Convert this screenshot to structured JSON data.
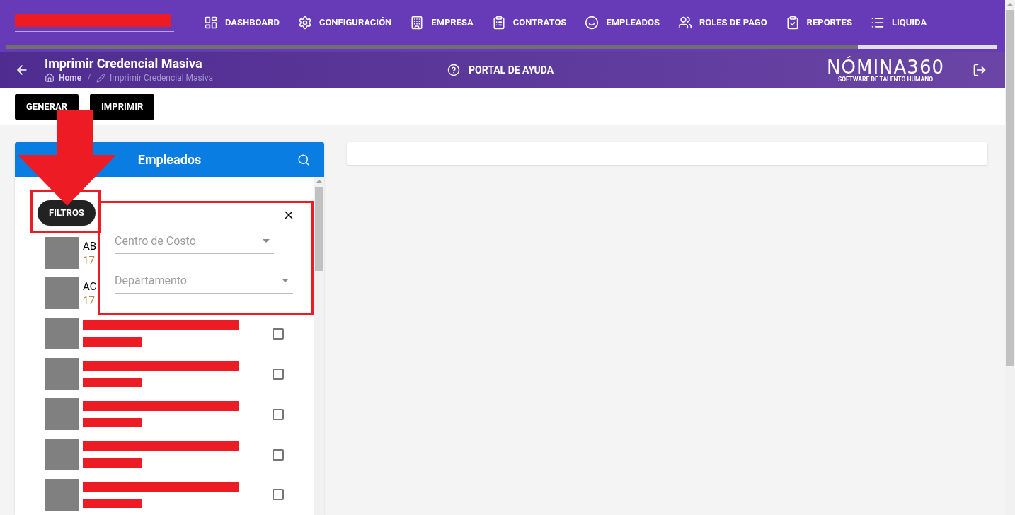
{
  "nav": {
    "progress": {
      "level": 0.86
    },
    "items": [
      {
        "label": "DASHBOARD"
      },
      {
        "label": "CONFIGURACIÓN"
      },
      {
        "label": "EMPRESA"
      },
      {
        "label": "CONTRATOS"
      },
      {
        "label": "EMPLEADOS"
      },
      {
        "label": "ROLES DE PAGO"
      },
      {
        "label": "REPORTES"
      },
      {
        "label": "LIQUIDA"
      }
    ]
  },
  "header": {
    "title": "Imprimir Credencial Masiva",
    "breadcrumb": [
      "Home",
      "/",
      "Imprimir Credencial Masiva"
    ],
    "help": "PORTAL DE AYUDA",
    "logo": {
      "name": "NÓMINA360",
      "tagline": "SOFTWARE DE TALENTO HUMANO"
    }
  },
  "actions": [
    "GENERAR",
    "IMPRIMIR"
  ],
  "employees_panel": {
    "title": "Empleados",
    "filter_button": "FILTROS",
    "filters": [
      {
        "placeholder": "Centro de Costo"
      },
      {
        "placeholder": "Departamento"
      }
    ],
    "rows": [
      {
        "kind": "partial",
        "name": "AB",
        "id": "17"
      },
      {
        "kind": "partial",
        "name": "AC",
        "id": "17"
      },
      {
        "kind": "redacted",
        "checked": false
      },
      {
        "kind": "redacted",
        "checked": false
      },
      {
        "kind": "redacted",
        "checked": false
      },
      {
        "kind": "redacted",
        "checked": false
      },
      {
        "kind": "redacted",
        "checked": false
      }
    ]
  }
}
